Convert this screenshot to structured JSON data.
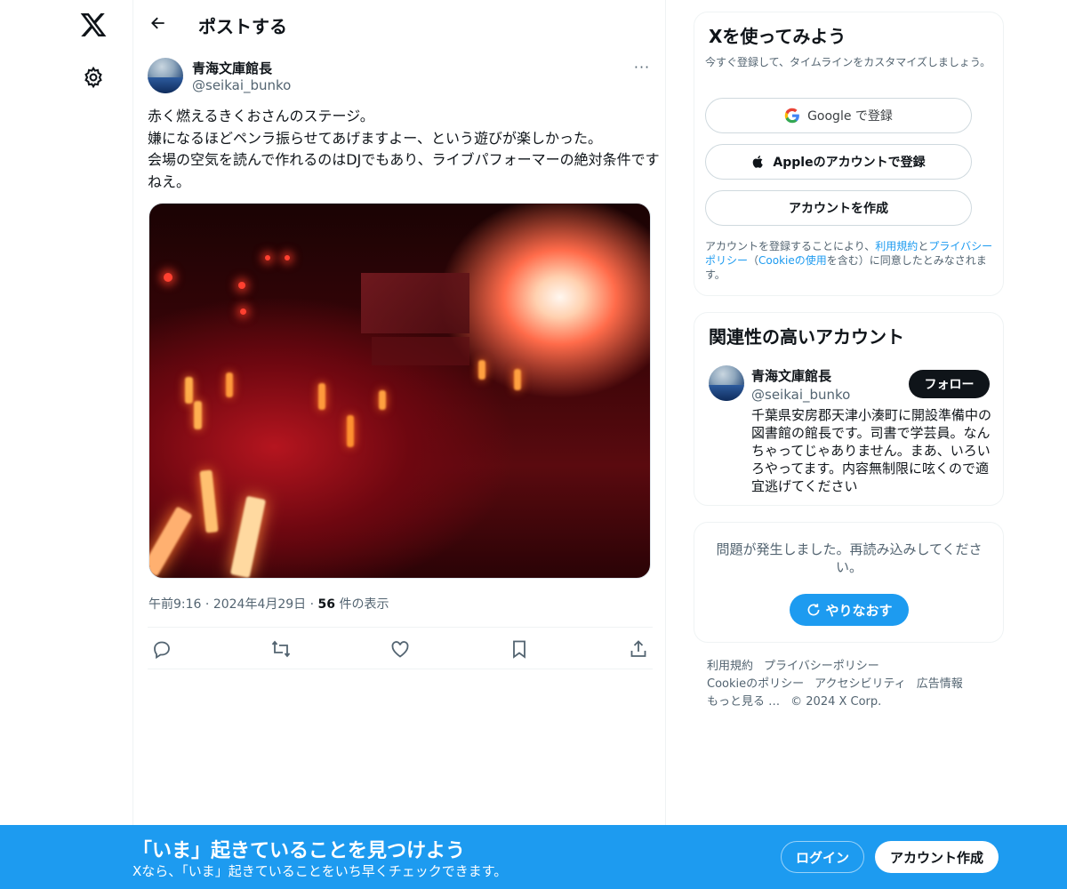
{
  "nav": {
    "logo_icon": "x-logo-icon",
    "settings_icon": "gear-icon"
  },
  "topbar": {
    "title": "ポストする",
    "back_icon": "arrow-left-icon"
  },
  "post": {
    "author_name": "青海文庫館長",
    "author_handle": "@seikai_bunko",
    "more_label": "···",
    "text": "赤く燃えるきくおさんのステージ。\n嫌になるほどペンラ振らせてあげますよー、という遊びが楽しかった。\n会場の空気を読んで作れるのはDJでもあり、ライブパフォーマーの絶対条件ですねえ。",
    "time": "午前9:16",
    "sep1": " · ",
    "date": "2024年4月29日",
    "sep2": " · ",
    "views_count": "56",
    "views_label": " 件の表示",
    "actions": [
      "reply-icon",
      "repost-icon",
      "like-icon",
      "bookmark-icon",
      "share-icon"
    ]
  },
  "signup": {
    "title": "Xを使ってみよう",
    "subtitle": "今すぐ登録して、タイムラインをカスタマイズしましょう。",
    "google_label": "Google で登録",
    "apple_label": "Appleのアカウントで登録",
    "create_label": "アカウントを作成",
    "legal_prefix": "アカウントを登録することにより、",
    "legal_terms": "利用規約",
    "legal_and": "と",
    "legal_privacy": "プライバシーポリシー",
    "legal_paren_open": "（",
    "legal_cookie": "Cookieの使用",
    "legal_suffix": "を含む）に同意したとみなされます。"
  },
  "related": {
    "title": "関連性の高いアカウント",
    "name": "青海文庫館長",
    "handle": "@seikai_bunko",
    "follow_label": "フォロー",
    "bio": "千葉県安房郡天津小湊町に開設準備中の図書館の館長です。司書で学芸員。なんちゃってじゃありません。まあ、いろいろやってます。内容無制限に呟くので適宜逃げてください"
  },
  "error": {
    "text": "問題が発生しました。再読み込みしてください。",
    "retry_label": "やりなおす"
  },
  "footer": {
    "terms": "利用規約",
    "privacy": "プライバシーポリシー",
    "cookie": "Cookieのポリシー",
    "accessibility": "アクセシビリティ",
    "ads": "広告情報",
    "more": "もっと見る …",
    "copyright": "© 2024 X Corp."
  },
  "banner": {
    "title": "「いま」起きていることを見つけよう",
    "subtitle": "Xなら、「いま」起きていることをいち早くチェックできます。",
    "login_label": "ログイン",
    "create_label": "アカウント作成"
  },
  "colors": {
    "accent": "#1d9bf0",
    "text": "#0f1419",
    "secondary": "#536471",
    "border": "#eff3f4"
  }
}
